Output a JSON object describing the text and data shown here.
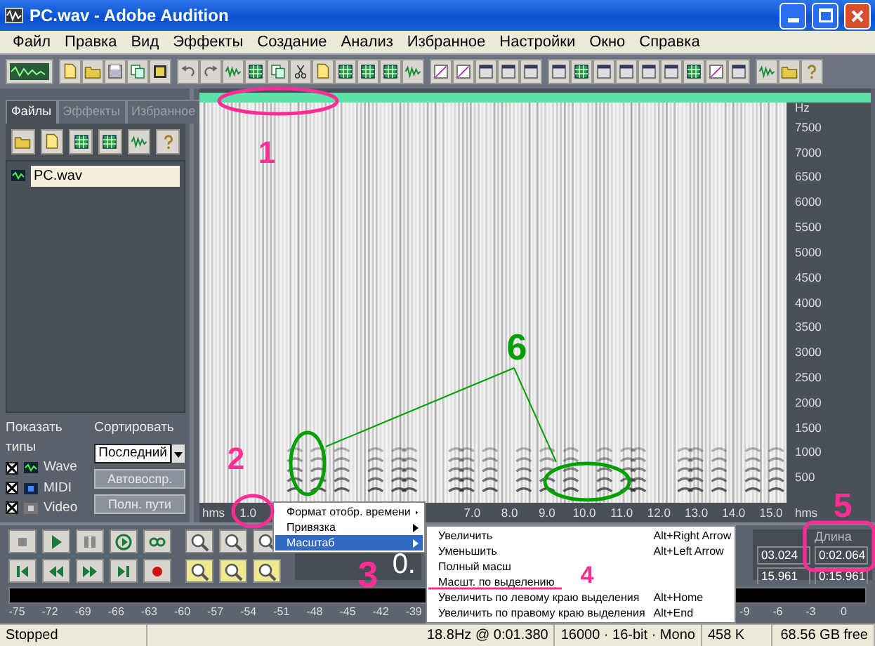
{
  "window": {
    "title": "PC.wav - Adobe Audition"
  },
  "menu": [
    "Файл",
    "Правка",
    "Вид",
    "Эффекты",
    "Создание",
    "Анализ",
    "Избранное",
    "Настройки",
    "Окно",
    "Справка"
  ],
  "file_panel": {
    "tabs": [
      {
        "label": "Файлы",
        "selected": true
      },
      {
        "label": "Эффекты",
        "selected": false
      },
      {
        "label": "Избранное",
        "selected": false
      }
    ],
    "files": [
      {
        "name": "PC.wav",
        "selected": true
      }
    ],
    "show_types": {
      "label": "Показать типы",
      "items": [
        {
          "label": "Wave",
          "checked": true
        },
        {
          "label": "MIDI",
          "checked": true
        },
        {
          "label": "Video",
          "checked": true
        }
      ]
    },
    "sort": {
      "label": "Сортировать",
      "value": "Последний"
    },
    "buttons": [
      "Автовоспр.",
      "Полн. пути"
    ]
  },
  "editor": {
    "frequency_axis": [
      "Hz",
      "7500",
      "7000",
      "6500",
      "6000",
      "5500",
      "5000",
      "4500",
      "4000",
      "3500",
      "3000",
      "2500",
      "2000",
      "1500",
      "1000",
      "500"
    ],
    "time_ruler": [
      "hms",
      "1.0",
      "7.0",
      "8.0",
      "9.0",
      "10.0",
      "11.0",
      "12.0",
      "13.0",
      "14.0",
      "15.0",
      "hms"
    ]
  },
  "time_display": "0.",
  "selection": {
    "columns": [
      "",
      "Длина"
    ],
    "rows": [
      [
        "03.024",
        "0:02.064"
      ],
      [
        "15.961",
        "0:15.961"
      ]
    ]
  },
  "level_meter": [
    "-75",
    "-72",
    "-69",
    "-66",
    "-63",
    "-60",
    "-57",
    "-54",
    "-51",
    "-48",
    "-45",
    "-42",
    "-39",
    "-9",
    "-6",
    "-3",
    "0"
  ],
  "status_bar": [
    "Stopped",
    "18.8Hz @ 0:01.380",
    "16000 · 16-bit · Mono",
    "458 K",
    "68.56 GB free"
  ],
  "context_menu": {
    "items": [
      {
        "label": "Формат отобр. времени",
        "selected": false
      },
      {
        "label": "Привязка",
        "selected": false
      },
      {
        "label": "Масштаб",
        "selected": true
      }
    ],
    "submenu": [
      {
        "label": "Увеличить",
        "shortcut": "Alt+Right Arrow"
      },
      {
        "label": "Уменьшить",
        "shortcut": "Alt+Left Arrow"
      },
      {
        "label": "Полный масш"
      },
      {
        "label": "Масшт. по выделению"
      },
      {
        "label": "Увеличить по левому краю выделения",
        "shortcut": "Alt+Home"
      },
      {
        "label": "Увеличить по правому краю выделения",
        "shortcut": "Alt+End"
      }
    ]
  },
  "annotations": [
    {
      "label": "1",
      "color": "#ff2d95"
    },
    {
      "label": "2",
      "color": "#ff2d95"
    },
    {
      "label": "3",
      "color": "#ff2d95"
    },
    {
      "label": "4",
      "color": "#ff2d95"
    },
    {
      "label": "5",
      "color": "#ff2d95"
    },
    {
      "label": "6",
      "color": "#00a000"
    }
  ]
}
